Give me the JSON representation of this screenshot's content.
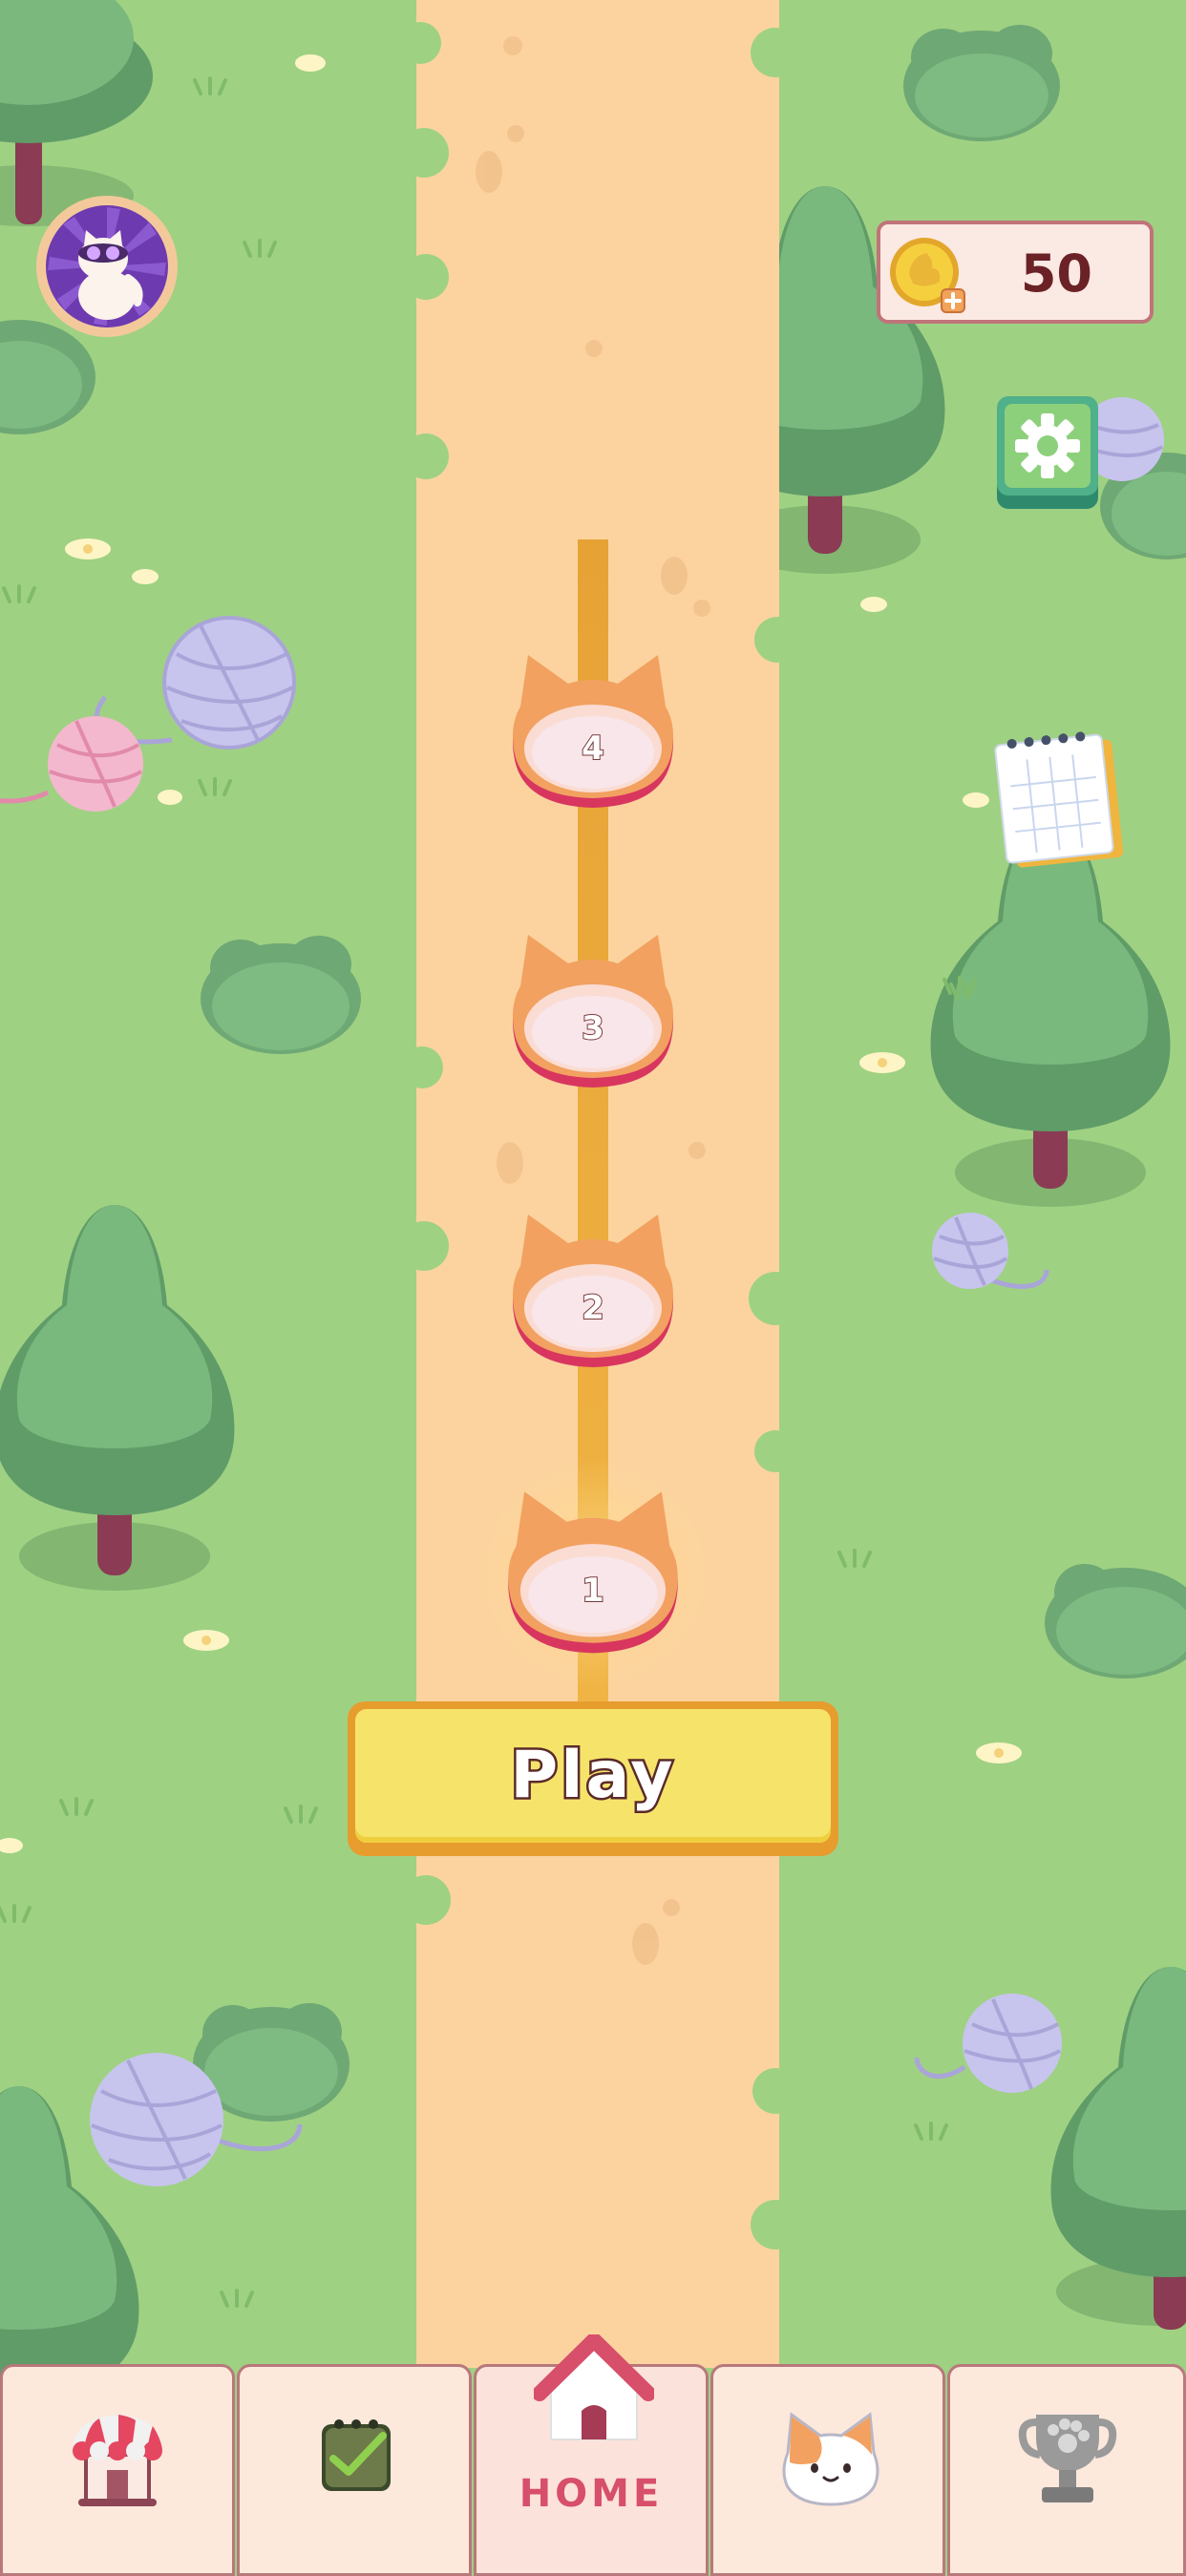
{
  "colors": {
    "grass": "#9fd183",
    "path": "#fcd39f",
    "tree_light": "#78ba7b",
    "tree_dark": "#5a9c64",
    "level_orange": "#f2a160",
    "level_rim": "#d8365f",
    "play_yellow": "#f6e46a",
    "coin_text": "#6b2226",
    "home_active": "#d74f6a"
  },
  "profile": {
    "icon": "cat-avatar-icon"
  },
  "coins": {
    "count": "50",
    "icon": "coin-plus-icon"
  },
  "settings": {
    "icon": "gear-icon"
  },
  "notepad": {
    "icon": "notepad-icon"
  },
  "levels": [
    {
      "label": "4"
    },
    {
      "label": "3"
    },
    {
      "label": "2"
    },
    {
      "label": "1"
    }
  ],
  "play_button": {
    "label": "Play"
  },
  "bottom_nav": {
    "tabs": [
      {
        "icon": "shop-icon",
        "label": ""
      },
      {
        "icon": "tasks-icon",
        "label": ""
      },
      {
        "icon": "home-icon",
        "label": "HOME"
      },
      {
        "icon": "cat-collection-icon",
        "label": ""
      },
      {
        "icon": "trophy-icon",
        "label": ""
      }
    ],
    "active_index": 2
  }
}
